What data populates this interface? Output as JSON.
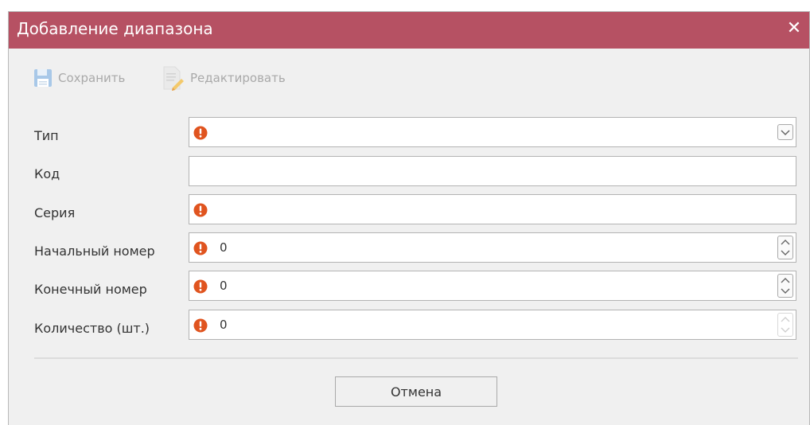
{
  "dialog": {
    "title": "Добавление диапазона",
    "close_glyph": "✕",
    "title_bg": "#b65163"
  },
  "toolbar": {
    "save_label": "Сохранить",
    "save_icon": "floppy-disk-icon",
    "edit_label": "Редактировать",
    "edit_icon": "document-edit-icon"
  },
  "form": {
    "type": {
      "label": "Тип",
      "value": ""
    },
    "code": {
      "label": "Код",
      "value": ""
    },
    "series": {
      "label": "Серия",
      "value": ""
    },
    "start_number": {
      "label": "Начальный номер",
      "value": "0"
    },
    "end_number": {
      "label": "Конечный номер",
      "value": "0"
    },
    "quantity": {
      "label": "Количество (шт.)",
      "value": "0"
    }
  },
  "validation_icon": "warning-icon",
  "warn_color": "#e0541f",
  "footer": {
    "cancel_label": "Отмена"
  }
}
